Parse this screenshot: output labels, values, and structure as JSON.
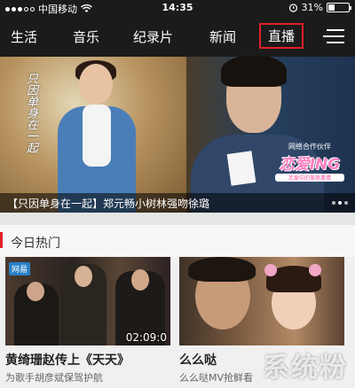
{
  "status_bar": {
    "carrier": "中国移动",
    "time": "14:35",
    "battery": "31%",
    "battery_level": 0.31
  },
  "nav": {
    "tabs": [
      "生活",
      "音乐",
      "纪录片",
      "新闻",
      "直播"
    ],
    "active_tab": "直播",
    "active_color": "#e0202a",
    "menu_icon": "hamburger-menu-icon"
  },
  "banner": {
    "calligraphy": "只因单身在一起",
    "caption": "【只因单身在一起】郑元畅小树林强吻徐璐",
    "partner_label": "网络合作伙伴",
    "partner_logo_text": "恋爱ING",
    "partner_logo_sub": "恋爱中的美丽事情",
    "page_indicator_count": 3,
    "page_indicator_active": 1
  },
  "section": {
    "title": "今日热门",
    "accent_color": "#e0202a"
  },
  "cards": [
    {
      "badge": "网易",
      "duration": "02:09:0",
      "title": "黄绮珊赵传上《天天》",
      "subtitle": "为歌手胡彦斌保驾护航"
    },
    {
      "duration": "",
      "title": "么么哒",
      "subtitle": "么么哒MV抢鲜看"
    }
  ],
  "watermark": "系统粉"
}
